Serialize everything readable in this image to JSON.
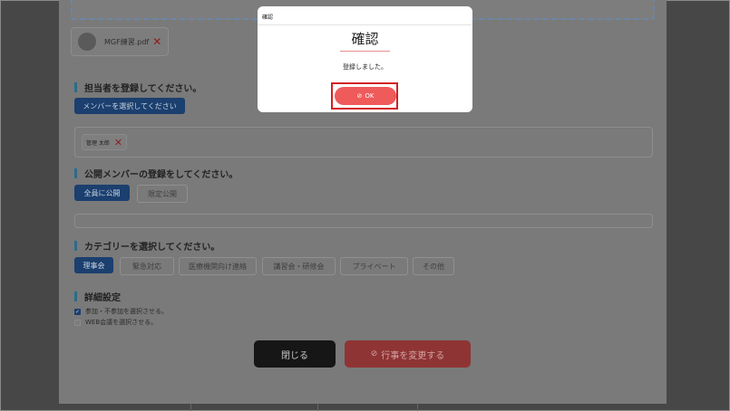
{
  "file": {
    "name": "MGF練習.pdf"
  },
  "sections": {
    "assignee_title": "担当者を登録してください。",
    "public_title": "公開メンバーの登録をしてください。",
    "category_title": "カテゴリーを選択してください。",
    "detail_title": "詳細設定"
  },
  "assignee": {
    "select_button": "メンバーを選択してください",
    "member_name": "管理 太郎"
  },
  "public": {
    "all_button": "全員に公開",
    "limited_button": "限定公開"
  },
  "categories": [
    "理事会",
    "緊急対応",
    "医療機関向け連絡",
    "講習会・研修会",
    "プライベート",
    "その他"
  ],
  "details": {
    "option1": "参加・不参加を選択させる。",
    "option2": "WEB会議を選択させる。",
    "option1_checked": true,
    "option2_checked": false
  },
  "footer": {
    "close_button": "閉じる",
    "change_button": "行事を変更する"
  },
  "modal": {
    "header": "確認",
    "title": "確認",
    "message": "登録しました。",
    "ok_button": "OK"
  },
  "colors": {
    "accent_blue": "#1b3f6e",
    "ok_red": "#ef5a5a",
    "highlight_red": "#d42020"
  }
}
